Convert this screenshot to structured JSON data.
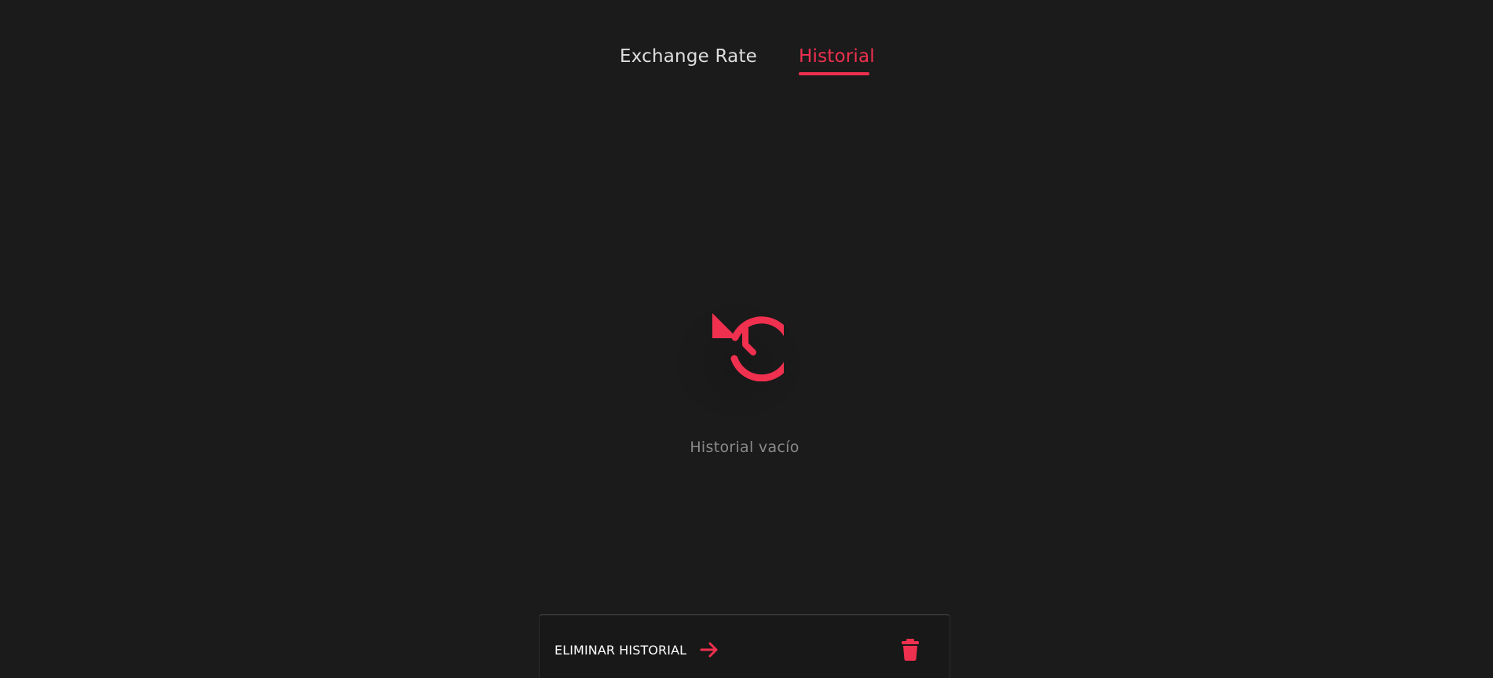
{
  "tabs": [
    {
      "label": "Exchange Rate",
      "active": false
    },
    {
      "label": "Historial",
      "active": true
    }
  ],
  "empty_state": {
    "icon": "history-icon",
    "message": "Historial vacío"
  },
  "bottom_bar": {
    "clear_label": "ELIMINAR HISTORIAL",
    "arrow_icon": "arrow-right-icon",
    "trash_icon": "trash-icon"
  },
  "colors": {
    "background": "#1b1b1b",
    "accent": "#f0304f",
    "tab_inactive": "#dedede",
    "muted_text": "#8a8a8a"
  }
}
